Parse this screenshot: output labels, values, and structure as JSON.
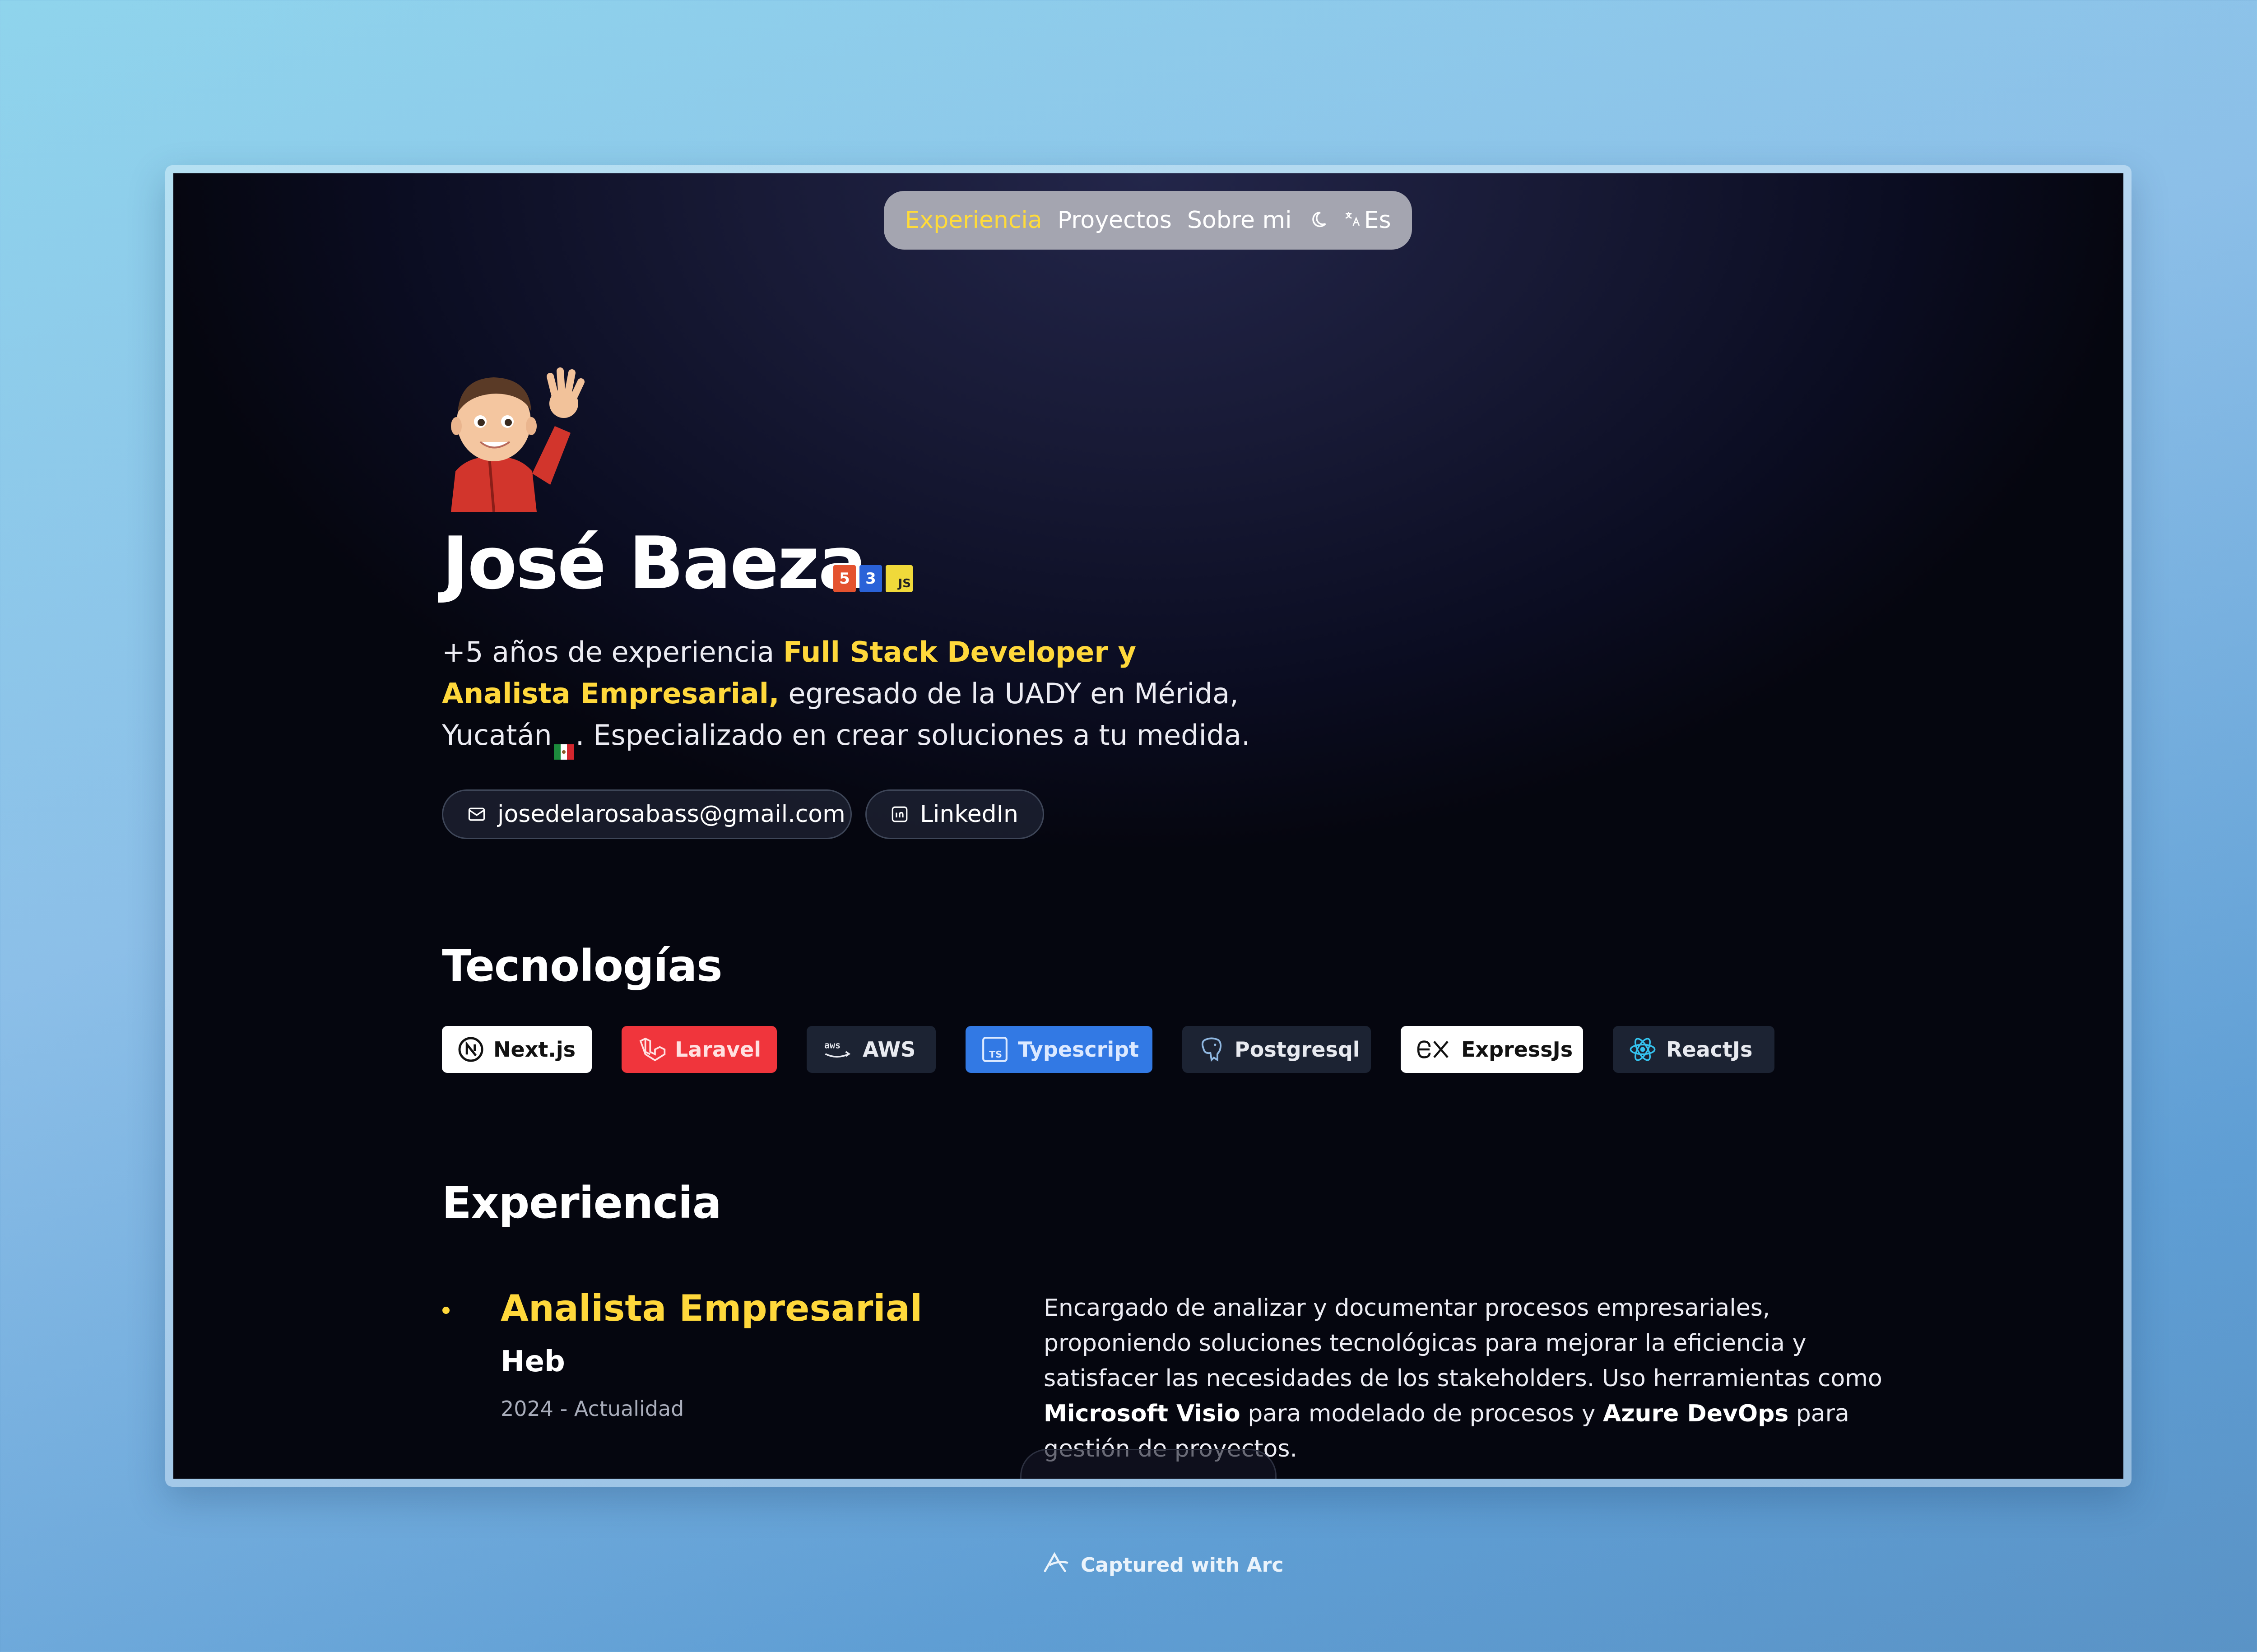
{
  "nav": {
    "items": [
      {
        "label": "Experiencia",
        "active": true
      },
      {
        "label": "Proyectos",
        "active": false
      },
      {
        "label": "Sobre mi",
        "active": false
      }
    ],
    "theme_icon": "moon-icon",
    "language_icon": "translate-icon",
    "language": "Es"
  },
  "hero": {
    "name": "José Baeza",
    "badges": [
      "5",
      "3",
      "JS"
    ],
    "intro": {
      "part1": "+5 años de experiencia ",
      "highlight": "Full Stack Developer y Analista Empresarial,",
      "part2": " egresado de la UADY en Mérida, Yucatán",
      "part3": ". Especializado en crear soluciones a tu medida."
    },
    "email": "josedelarosabass@gmail.com",
    "linkedin": "LinkedIn"
  },
  "tech": {
    "title": "Tecnologías",
    "items": [
      {
        "label": "Next.js",
        "icon": "nextjs-icon"
      },
      {
        "label": "Laravel",
        "icon": "laravel-icon"
      },
      {
        "label": "AWS",
        "icon": "aws-icon"
      },
      {
        "label": "Typescript",
        "icon": "typescript-icon"
      },
      {
        "label": "Postgresql",
        "icon": "postgresql-icon"
      },
      {
        "label": "ExpressJs",
        "icon": "express-icon"
      },
      {
        "label": "ReactJs",
        "icon": "react-icon"
      }
    ]
  },
  "experience": {
    "title": "Experiencia",
    "jobs": [
      {
        "title": "Analista Empresarial",
        "company": "Heb",
        "dates": "2024 - Actualidad",
        "desc": {
          "p1": "Encargado de analizar y documentar procesos empresariales, proponiendo soluciones tecnológicas para mejorar la eficiencia y satisfacer las necesidades de los stakeholders. Uso herramientas como ",
          "b1": "Microsoft Visio",
          "p2": " para modelado de procesos y ",
          "b2": "Azure DevOps",
          "p3": " para gestión de proyectos."
        }
      }
    ]
  },
  "footer": {
    "capture_text": "Captured with Arc"
  },
  "colors": {
    "accent": "#ffd83b",
    "background": "#0b0d22",
    "nav_bg": "#a4a5b0"
  }
}
